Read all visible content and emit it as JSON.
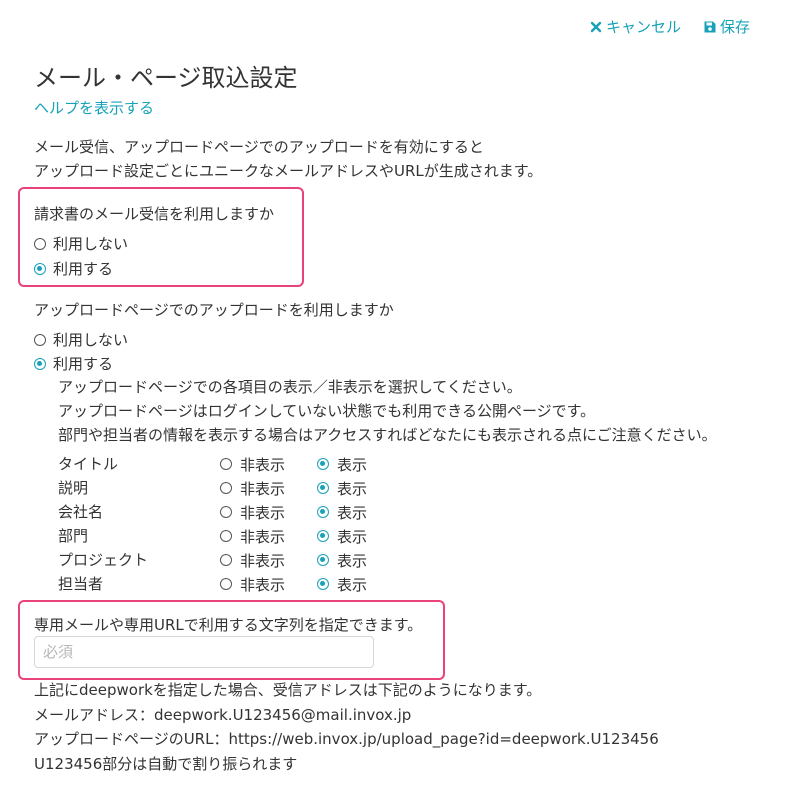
{
  "toolbar": {
    "cancel_label": "キャンセル",
    "save_label": "保存"
  },
  "page": {
    "title": "メール・ページ取込設定",
    "help_link": "ヘルプを表示する"
  },
  "intro": {
    "line1": "メール受信、アップロードページでのアップロードを有効にすると",
    "line2": "アップロード設定ごとにユニークなメールアドレスやURLが生成されます。"
  },
  "email_receipt": {
    "question": "請求書のメール受信を利用しますか",
    "options": [
      "利用しない",
      "利用する"
    ],
    "selected": "利用する"
  },
  "upload_page": {
    "question": "アップロードページでのアップロードを利用しますか",
    "options": [
      "利用しない",
      "利用する"
    ],
    "selected": "利用する",
    "description": [
      "アップロードページでの各項目の表示／非表示を選択してください。",
      "アップロードページはログインしていない状態でも利用できる公開ページです。",
      "部門や担当者の情報を表示する場合はアクセスすればどなたにも表示される点にご注意ください。"
    ],
    "hide_label": "非表示",
    "show_label": "表示",
    "fields": [
      {
        "label": "タイトル",
        "selected": "show"
      },
      {
        "label": "説明",
        "selected": "show"
      },
      {
        "label": "会社名",
        "selected": "show"
      },
      {
        "label": "部門",
        "selected": "show"
      },
      {
        "label": "プロジェクト",
        "selected": "show"
      },
      {
        "label": "担当者",
        "selected": "show"
      }
    ]
  },
  "prefix": {
    "label": "専用メールや専用URLで利用する文字列を指定できます。",
    "placeholder": "必須",
    "value": ""
  },
  "example": {
    "line1": "上記にdeepworkを指定した場合、受信アドレスは下記のようになります。",
    "line2": "メールアドレス：deepwork.U123456@mail.invox.jp",
    "line3": "アップロードページのURL：https://web.invox.jp/upload_page?id=deepwork.U123456",
    "line4": "U123456部分は自動で割り振られます"
  },
  "colors": {
    "accent": "#17a2b8",
    "highlight": "#e8437a",
    "text": "#333333"
  }
}
